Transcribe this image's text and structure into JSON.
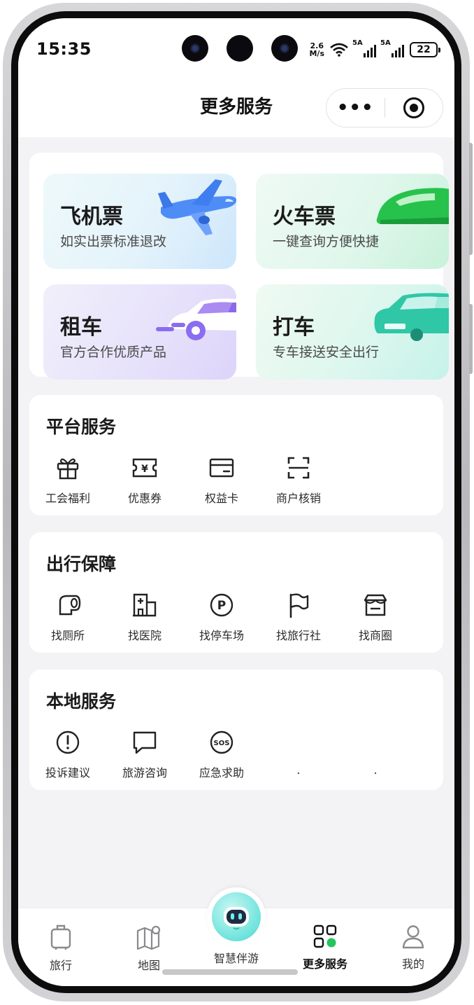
{
  "status_bar": {
    "time": "15:35",
    "net_speed_value": "2.6",
    "net_speed_unit": "M/s",
    "signal1_label": "5A",
    "signal2_label": "5A",
    "battery": "22"
  },
  "nav": {
    "title": "更多服务",
    "more_label": "•••"
  },
  "top_cards": [
    {
      "title": "飞机票",
      "subtitle": "如实出票标准退改"
    },
    {
      "title": "火车票",
      "subtitle": "一键查询方便快捷"
    },
    {
      "title": "租车",
      "subtitle": "官方合作优质产品"
    },
    {
      "title": "打车",
      "subtitle": "专车接送安全出行"
    }
  ],
  "sections": {
    "platform": {
      "title": "平台服务",
      "items": [
        {
          "label": "工会福利",
          "icon": "gift-icon"
        },
        {
          "label": "优惠券",
          "icon": "coupon-icon"
        },
        {
          "label": "权益卡",
          "icon": "card-icon"
        },
        {
          "label": "商户核销",
          "icon": "scan-icon"
        }
      ]
    },
    "travel": {
      "title": "出行保障",
      "items": [
        {
          "label": "找厕所",
          "icon": "toilet-icon"
        },
        {
          "label": "找医院",
          "icon": "hospital-icon"
        },
        {
          "label": "找停车场",
          "icon": "parking-icon"
        },
        {
          "label": "找旅行社",
          "icon": "flag-icon"
        },
        {
          "label": "找商圈",
          "icon": "shop-icon"
        }
      ]
    },
    "local": {
      "title": "本地服务",
      "items": [
        {
          "label": "投诉建议",
          "icon": "alert-icon"
        },
        {
          "label": "旅游咨询",
          "icon": "chat-icon"
        },
        {
          "label": "应急求助",
          "icon": "sos-icon"
        },
        {
          "label": "."
        },
        {
          "label": "."
        }
      ]
    }
  },
  "tabbar": {
    "tabs": [
      {
        "label": "旅行",
        "icon": "luggage-icon"
      },
      {
        "label": "地图",
        "icon": "map-icon"
      },
      {
        "label": "智慧伴游",
        "icon": "robot-icon"
      },
      {
        "label": "更多服务",
        "icon": "grid-icon",
        "active": true
      },
      {
        "label": "我的",
        "icon": "user-icon"
      }
    ]
  },
  "colors": {
    "accent_green": "#22c55e",
    "page_bg": "#f3f3f5"
  }
}
